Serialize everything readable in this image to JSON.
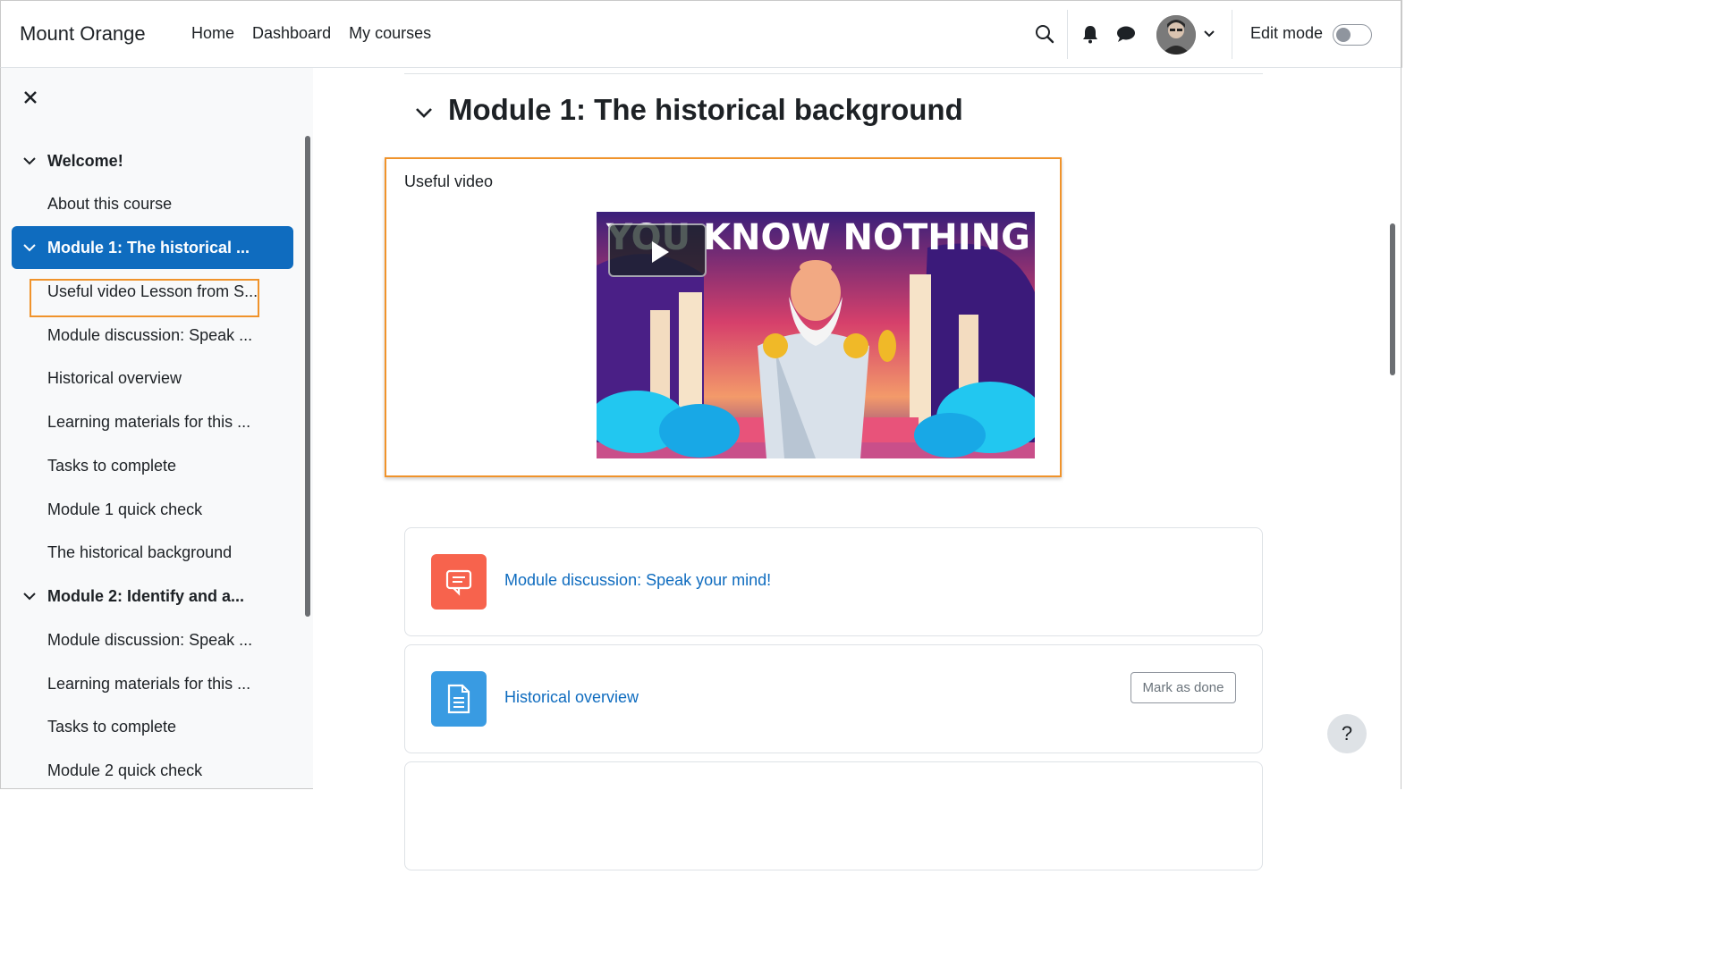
{
  "navbar": {
    "brand": "Mount Orange",
    "links": [
      "Home",
      "Dashboard",
      "My courses"
    ],
    "edit_mode_label": "Edit mode",
    "edit_mode_on": false
  },
  "course_index": {
    "items": [
      {
        "type": "section",
        "label": "Welcome!"
      },
      {
        "type": "activity",
        "label": "About this course"
      },
      {
        "type": "section",
        "label": "Module 1: The historical ...",
        "active": true
      },
      {
        "type": "activity",
        "label": "Useful video Lesson from S...",
        "highlighted": true
      },
      {
        "type": "activity",
        "label": "Module discussion: Speak ..."
      },
      {
        "type": "activity",
        "label": "Historical overview"
      },
      {
        "type": "activity",
        "label": "Learning materials for this ..."
      },
      {
        "type": "activity",
        "label": "Tasks to complete"
      },
      {
        "type": "activity",
        "label": "Module 1 quick check"
      },
      {
        "type": "activity",
        "label": "The historical background"
      },
      {
        "type": "section",
        "label": "Module 2: Identify and a..."
      },
      {
        "type": "activity",
        "label": "Module discussion: Speak ..."
      },
      {
        "type": "activity",
        "label": "Learning materials for this ..."
      },
      {
        "type": "activity",
        "label": "Tasks to complete"
      },
      {
        "type": "activity",
        "label": "Module 2 quick check"
      }
    ]
  },
  "main": {
    "section_title": "Module 1: The historical background",
    "video": {
      "label": "Useful video",
      "thumbnail_text": "YOU KNOW NOTHING"
    },
    "activities": [
      {
        "icon": "forum-icon",
        "color": "#f7634d",
        "label": "Module discussion: Speak your mind!",
        "mark_done": ""
      },
      {
        "icon": "page-icon",
        "color": "#399be2",
        "label": "Historical overview",
        "mark_done": "Mark as done"
      }
    ]
  },
  "help": {
    "label": "?"
  }
}
